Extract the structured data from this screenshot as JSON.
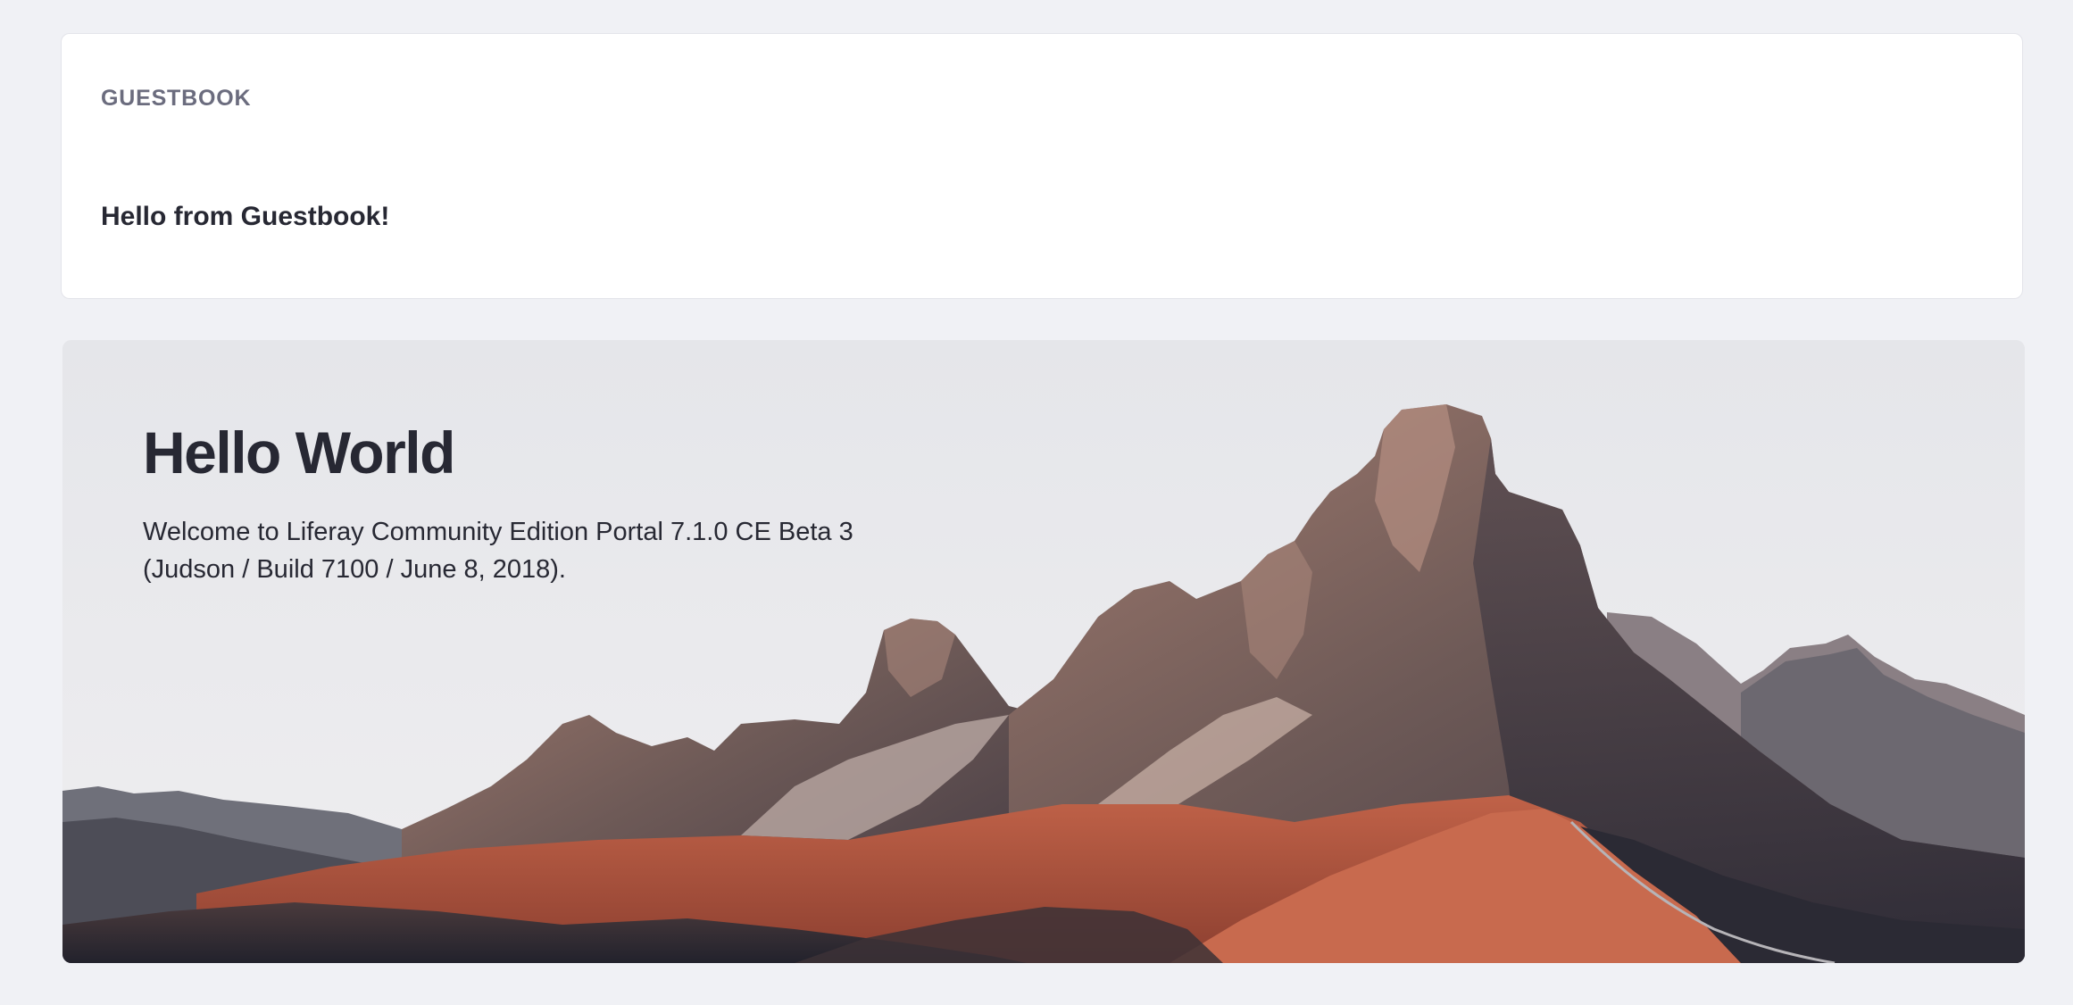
{
  "guestbook": {
    "title": "GUESTBOOK",
    "message": "Hello from Guestbook!"
  },
  "hero": {
    "title": "Hello World",
    "text": "Welcome to Liferay Community Edition Portal 7.1.0 CE Beta 3 (Judson / Build 7100 / June 8, 2018).",
    "image": "mountain-landscape"
  },
  "colors": {
    "page_background": "#f0f1f5",
    "card_background": "#ffffff",
    "text_dark": "#272833",
    "text_muted": "#6b6c7e"
  }
}
